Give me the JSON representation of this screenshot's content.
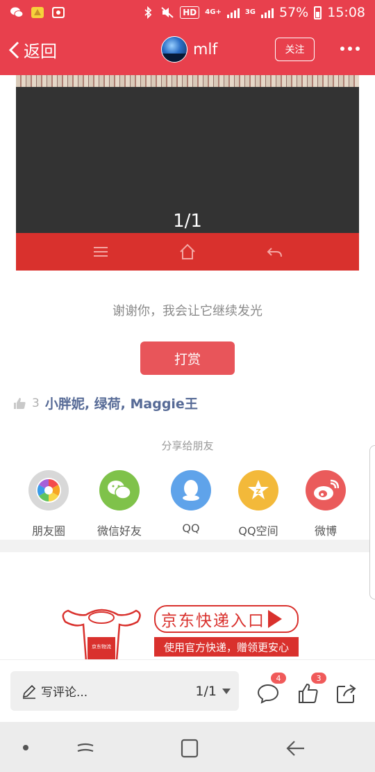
{
  "status_bar": {
    "hd_label": "HD",
    "network_top": "4G+",
    "network_3g": "3G",
    "battery": "57%",
    "time": "15:08",
    "icons": [
      "wechat-icon",
      "notification-app-icon",
      "music-app-icon",
      "bluetooth-icon",
      "mute-icon",
      "signal-icon",
      "battery-icon"
    ]
  },
  "header": {
    "back_label": "返回",
    "username": "mlf",
    "follow_label": "关注"
  },
  "viewer": {
    "page_indicator": "1/1"
  },
  "thanks_text": "谢谢你，我会让它继续发光",
  "reward_label": "打赏",
  "likes": {
    "count": "3",
    "names": "小胖妮, 绿荷, Maggie王"
  },
  "share": {
    "title": "分享给朋友",
    "items": [
      {
        "label": "朋友圈",
        "icon": "moments-icon",
        "color": "#d8d8d8"
      },
      {
        "label": "微信好友",
        "icon": "wechat-icon",
        "color": "#7fc24a"
      },
      {
        "label": "QQ",
        "icon": "qq-icon",
        "color": "#5fa3ea"
      },
      {
        "label": "QQ空间",
        "icon": "qzone-icon",
        "color": "#f3b93a"
      },
      {
        "label": "微博",
        "icon": "weibo-icon",
        "color": "#ea5b5b"
      }
    ]
  },
  "ad": {
    "logo_text": "京东物流",
    "headline": "京东快递入口",
    "subline": "使用官方快递，赠领更安心"
  },
  "comment_bar": {
    "placeholder": "写评论...",
    "page": "1/1",
    "comment_count": "4",
    "like_count": "3"
  },
  "colors": {
    "brand_red": "#e8404d",
    "viewer_bar_red": "#d9312d",
    "reward_red": "#e8555a",
    "like_names_blue": "#566a96"
  }
}
